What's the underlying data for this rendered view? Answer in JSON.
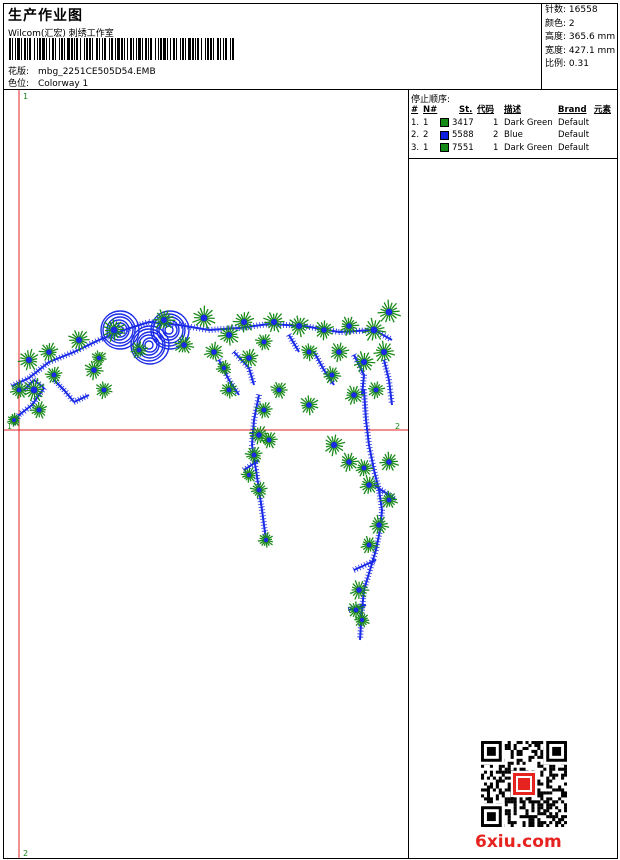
{
  "header": {
    "title": "生产作业图",
    "company": "Wilcom(汇宏) 刺绣工作室",
    "design_label": "花版:",
    "design_file": "mbg_2251CE505D54.EMB",
    "colorway_label": "色位:",
    "colorway": "Colorway 1"
  },
  "stats": [
    {
      "label": "针数:",
      "value": "16558"
    },
    {
      "label": "颜色:",
      "value": "2"
    },
    {
      "label": "高度:",
      "value": "365.6 mm"
    },
    {
      "label": "宽度:",
      "value": "427.1 mm"
    },
    {
      "label": "比例:",
      "value": "0.31"
    }
  ],
  "canvas": {
    "axis_top_label": "1",
    "axis_bottom_label": "2",
    "axis_left_label": "1",
    "axis_right_label": "2",
    "thread_green": "#1a8a1a",
    "thread_blue": "#1a2ae6",
    "guide_color": "#e02020"
  },
  "stop_sequence": {
    "title": "停止顺序:",
    "headers": {
      "idx": "#",
      "no": "N#",
      "st": "St.",
      "code": "代码",
      "desc": "描述",
      "brand": "Brand",
      "element": "元素"
    },
    "rows": [
      {
        "idx": "1.",
        "no": "1",
        "color": "#168a16",
        "st": "3417",
        "code": "1",
        "desc": "Dark Green",
        "brand": "Default"
      },
      {
        "idx": "2.",
        "no": "2",
        "color": "#1020e0",
        "st": "5588",
        "code": "2",
        "desc": "Blue",
        "brand": "Default"
      },
      {
        "idx": "3.",
        "no": "1",
        "color": "#168a16",
        "st": "7551",
        "code": "1",
        "desc": "Dark Green",
        "brand": "Default"
      }
    ]
  },
  "watermark": {
    "text": "6xiu.com",
    "color": "#e6231f"
  }
}
